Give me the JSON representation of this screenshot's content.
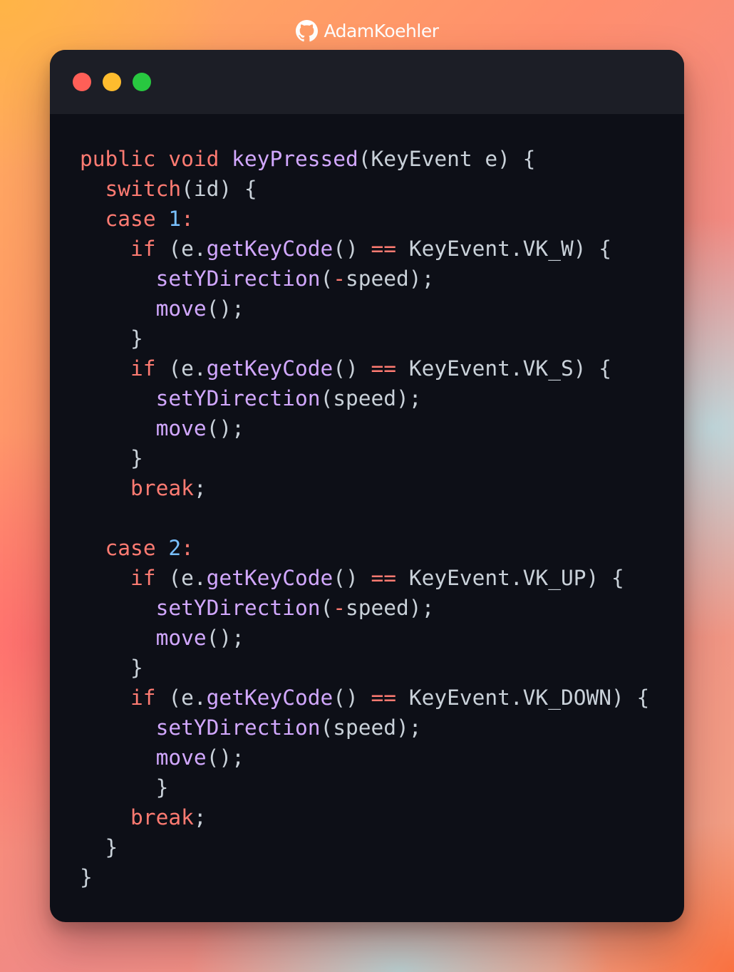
{
  "badge": {
    "username": "AdamKoehler",
    "icon": "github-icon"
  },
  "window": {
    "controls": [
      "close",
      "minimize",
      "maximize"
    ],
    "colors": {
      "background": "#0d0f17",
      "titlebar": "#1c1e26",
      "close": "#ff5f57",
      "minimize": "#febc2e",
      "maximize": "#28c840"
    }
  },
  "syntax_colors": {
    "keyword": "#ff7b72",
    "function": "#d2a8ff",
    "number": "#79c0ff",
    "plain": "#c9d1d9"
  },
  "code": {
    "language": "java",
    "lines": [
      [
        [
          "kw",
          "public"
        ],
        [
          "pl",
          " "
        ],
        [
          "kw",
          "void"
        ],
        [
          "pl",
          " "
        ],
        [
          "fn",
          "keyPressed"
        ],
        [
          "pl",
          "(KeyEvent e) {"
        ]
      ],
      [
        [
          "pl",
          "  "
        ],
        [
          "kw",
          "switch"
        ],
        [
          "pl",
          "(id) {"
        ]
      ],
      [
        [
          "pl",
          "  "
        ],
        [
          "kw",
          "case"
        ],
        [
          "pl",
          " "
        ],
        [
          "num",
          "1"
        ],
        [
          "kw",
          ":"
        ]
      ],
      [
        [
          "pl",
          "    "
        ],
        [
          "kw",
          "if"
        ],
        [
          "pl",
          " (e."
        ],
        [
          "fn",
          "getKeyCode"
        ],
        [
          "pl",
          "() "
        ],
        [
          "kw",
          "=="
        ],
        [
          "pl",
          " KeyEvent.VK_W) {"
        ]
      ],
      [
        [
          "pl",
          "      "
        ],
        [
          "fn",
          "setYDirection"
        ],
        [
          "pl",
          "("
        ],
        [
          "kw",
          "-"
        ],
        [
          "pl",
          "speed);"
        ]
      ],
      [
        [
          "pl",
          "      "
        ],
        [
          "fn",
          "move"
        ],
        [
          "pl",
          "();"
        ]
      ],
      [
        [
          "pl",
          "    }"
        ]
      ],
      [
        [
          "pl",
          "    "
        ],
        [
          "kw",
          "if"
        ],
        [
          "pl",
          " (e."
        ],
        [
          "fn",
          "getKeyCode"
        ],
        [
          "pl",
          "() "
        ],
        [
          "kw",
          "=="
        ],
        [
          "pl",
          " KeyEvent.VK_S) {"
        ]
      ],
      [
        [
          "pl",
          "      "
        ],
        [
          "fn",
          "setYDirection"
        ],
        [
          "pl",
          "(speed);"
        ]
      ],
      [
        [
          "pl",
          "      "
        ],
        [
          "fn",
          "move"
        ],
        [
          "pl",
          "();"
        ]
      ],
      [
        [
          "pl",
          "    }"
        ]
      ],
      [
        [
          "pl",
          "    "
        ],
        [
          "kw",
          "break"
        ],
        [
          "pl",
          ";"
        ]
      ],
      [],
      [
        [
          "pl",
          "  "
        ],
        [
          "kw",
          "case"
        ],
        [
          "pl",
          " "
        ],
        [
          "num",
          "2"
        ],
        [
          "kw",
          ":"
        ]
      ],
      [
        [
          "pl",
          "    "
        ],
        [
          "kw",
          "if"
        ],
        [
          "pl",
          " (e."
        ],
        [
          "fn",
          "getKeyCode"
        ],
        [
          "pl",
          "() "
        ],
        [
          "kw",
          "=="
        ],
        [
          "pl",
          " KeyEvent.VK_UP) {"
        ]
      ],
      [
        [
          "pl",
          "      "
        ],
        [
          "fn",
          "setYDirection"
        ],
        [
          "pl",
          "("
        ],
        [
          "kw",
          "-"
        ],
        [
          "pl",
          "speed);"
        ]
      ],
      [
        [
          "pl",
          "      "
        ],
        [
          "fn",
          "move"
        ],
        [
          "pl",
          "();"
        ]
      ],
      [
        [
          "pl",
          "    }"
        ]
      ],
      [
        [
          "pl",
          "    "
        ],
        [
          "kw",
          "if"
        ],
        [
          "pl",
          " (e."
        ],
        [
          "fn",
          "getKeyCode"
        ],
        [
          "pl",
          "() "
        ],
        [
          "kw",
          "=="
        ],
        [
          "pl",
          " KeyEvent.VK_DOWN) {"
        ]
      ],
      [
        [
          "pl",
          "      "
        ],
        [
          "fn",
          "setYDirection"
        ],
        [
          "pl",
          "(speed);"
        ]
      ],
      [
        [
          "pl",
          "      "
        ],
        [
          "fn",
          "move"
        ],
        [
          "pl",
          "();"
        ]
      ],
      [
        [
          "pl",
          "      }"
        ]
      ],
      [
        [
          "pl",
          "    "
        ],
        [
          "kw",
          "break"
        ],
        [
          "pl",
          ";"
        ]
      ],
      [
        [
          "pl",
          "  }"
        ]
      ],
      [
        [
          "pl",
          "}"
        ]
      ]
    ]
  }
}
